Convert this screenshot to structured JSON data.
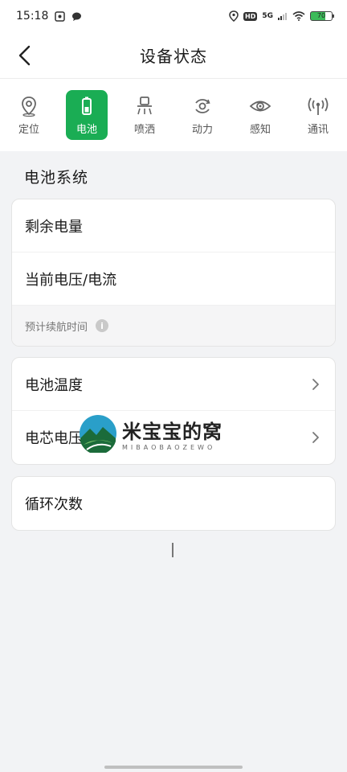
{
  "status_bar": {
    "time": "15:18",
    "battery_level": "70",
    "network": "5G",
    "hd_badge": "HD"
  },
  "header": {
    "title": "设备状态"
  },
  "tabs": [
    {
      "label": "定位",
      "icon": "location-icon",
      "active": false
    },
    {
      "label": "电池",
      "icon": "battery-icon",
      "active": true
    },
    {
      "label": "喷洒",
      "icon": "sprayer-icon",
      "active": false
    },
    {
      "label": "动力",
      "icon": "power-icon",
      "active": false
    },
    {
      "label": "感知",
      "icon": "eye-icon",
      "active": false
    },
    {
      "label": "通讯",
      "icon": "signal-icon",
      "active": false
    }
  ],
  "section_title": "电池系统",
  "card1": {
    "remaining": "剩余电量",
    "voltage_current": "当前电压/电流",
    "est_time": "预计续航时间"
  },
  "card2": {
    "temperature": "电池温度",
    "cell_voltage": "电芯电压"
  },
  "card3": {
    "cycles": "循环次数"
  },
  "watermark": {
    "title": "米宝宝的窝",
    "subtitle": "MIBAOBAOZEWO"
  },
  "colors": {
    "accent": "#1aad54",
    "background": "#f2f3f5"
  }
}
